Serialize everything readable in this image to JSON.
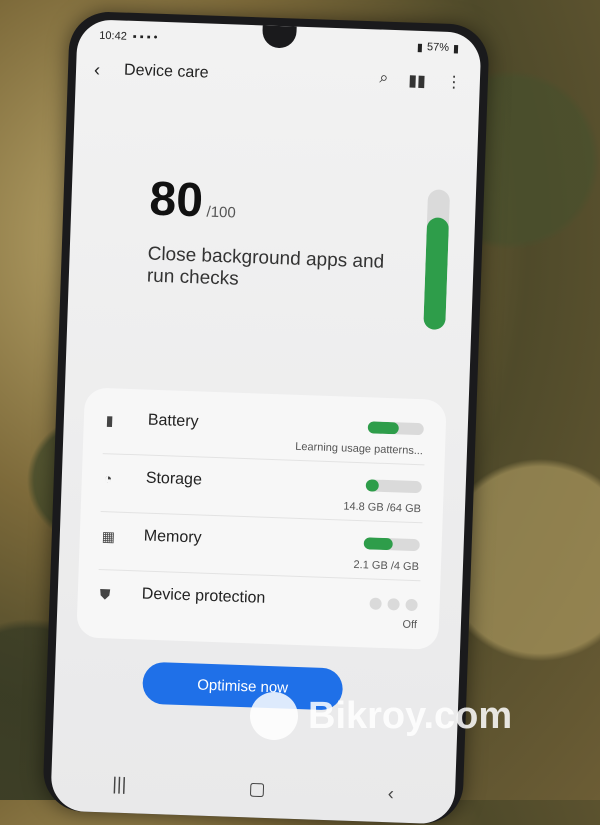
{
  "status_bar": {
    "time": "10:42",
    "battery": "57%"
  },
  "header": {
    "title": "Device care"
  },
  "score": {
    "value": "80",
    "max": "/100",
    "message": "Close background apps and run checks",
    "fraction": 0.8
  },
  "items": [
    {
      "label": "Battery",
      "sub": "Learning usage patterns...",
      "bar_fraction": 0.55,
      "icon": "battery-icon"
    },
    {
      "label": "Storage",
      "sub": "14.8 GB /64 GB",
      "bar_fraction": 0.23,
      "icon": "storage-pie-icon"
    },
    {
      "label": "Memory",
      "sub": "2.1 GB /4 GB",
      "bar_fraction": 0.52,
      "icon": "memory-chip-icon"
    },
    {
      "label": "Device protection",
      "sub": "Off",
      "icon": "shield-icon"
    }
  ],
  "button": {
    "label": "Optimise now"
  },
  "watermark": {
    "text": "Bikroy.com"
  },
  "colors": {
    "accent_green": "#2e9d4a",
    "button_blue": "#1f70e8"
  }
}
